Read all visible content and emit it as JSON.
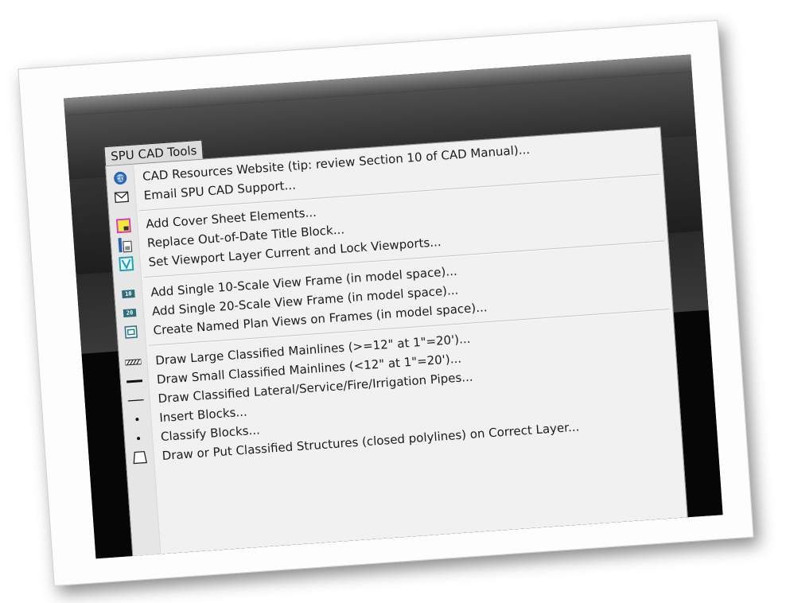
{
  "menu": {
    "title": "SPU CAD Tools",
    "items": [
      {
        "label": "CAD Resources Website (tip: review Section 10 of CAD Manual)...",
        "icon": "globe-icon"
      },
      {
        "label": "Email SPU CAD Support...",
        "icon": "envelope-icon"
      },
      {
        "label": "Add Cover Sheet Elements...",
        "icon": "cover-sheet-icon"
      },
      {
        "label": "Replace Out-of-Date Title Block...",
        "icon": "title-block-icon"
      },
      {
        "label": "Set Viewport Layer Current and Lock Viewports...",
        "icon": "viewport-icon"
      },
      {
        "label": "Add Single 10-Scale View Frame (in model space)...",
        "icon": "scale-10-icon",
        "badge": "10"
      },
      {
        "label": "Add Single 20-Scale View Frame (in model space)...",
        "icon": "scale-20-icon",
        "badge": "20"
      },
      {
        "label": "Create Named Plan Views on Frames (in model space)...",
        "icon": "plan-view-icon"
      },
      {
        "label": "Draw Large Classified Mainlines (>=12\" at 1\"=20')...",
        "icon": "hatched-line-icon"
      },
      {
        "label": "Draw Small Classified Mainlines (<12\" at 1\"=20')...",
        "icon": "thick-line-icon"
      },
      {
        "label": "Draw Classified Lateral/Service/Fire/Irrigation Pipes...",
        "icon": "thin-line-icon"
      },
      {
        "label": "Insert Blocks...",
        "icon": "dot-icon"
      },
      {
        "label": "Classify Blocks...",
        "icon": "dot-icon"
      },
      {
        "label": "Draw or Put Classified Structures (closed polylines) on Correct Layer...",
        "icon": "polyline-shape-icon"
      }
    ]
  },
  "colors": {
    "menu_bg": "#f1f1f1",
    "icon_strip": "#e6e6e6",
    "dark_ui": "#080808",
    "badge": "#2f6d7a",
    "cover_icon_border": "#d63ab8",
    "cover_icon_fill": "#f2e640",
    "viewport_icon": "#1a9fb5",
    "globe_icon": "#2a62b8"
  }
}
